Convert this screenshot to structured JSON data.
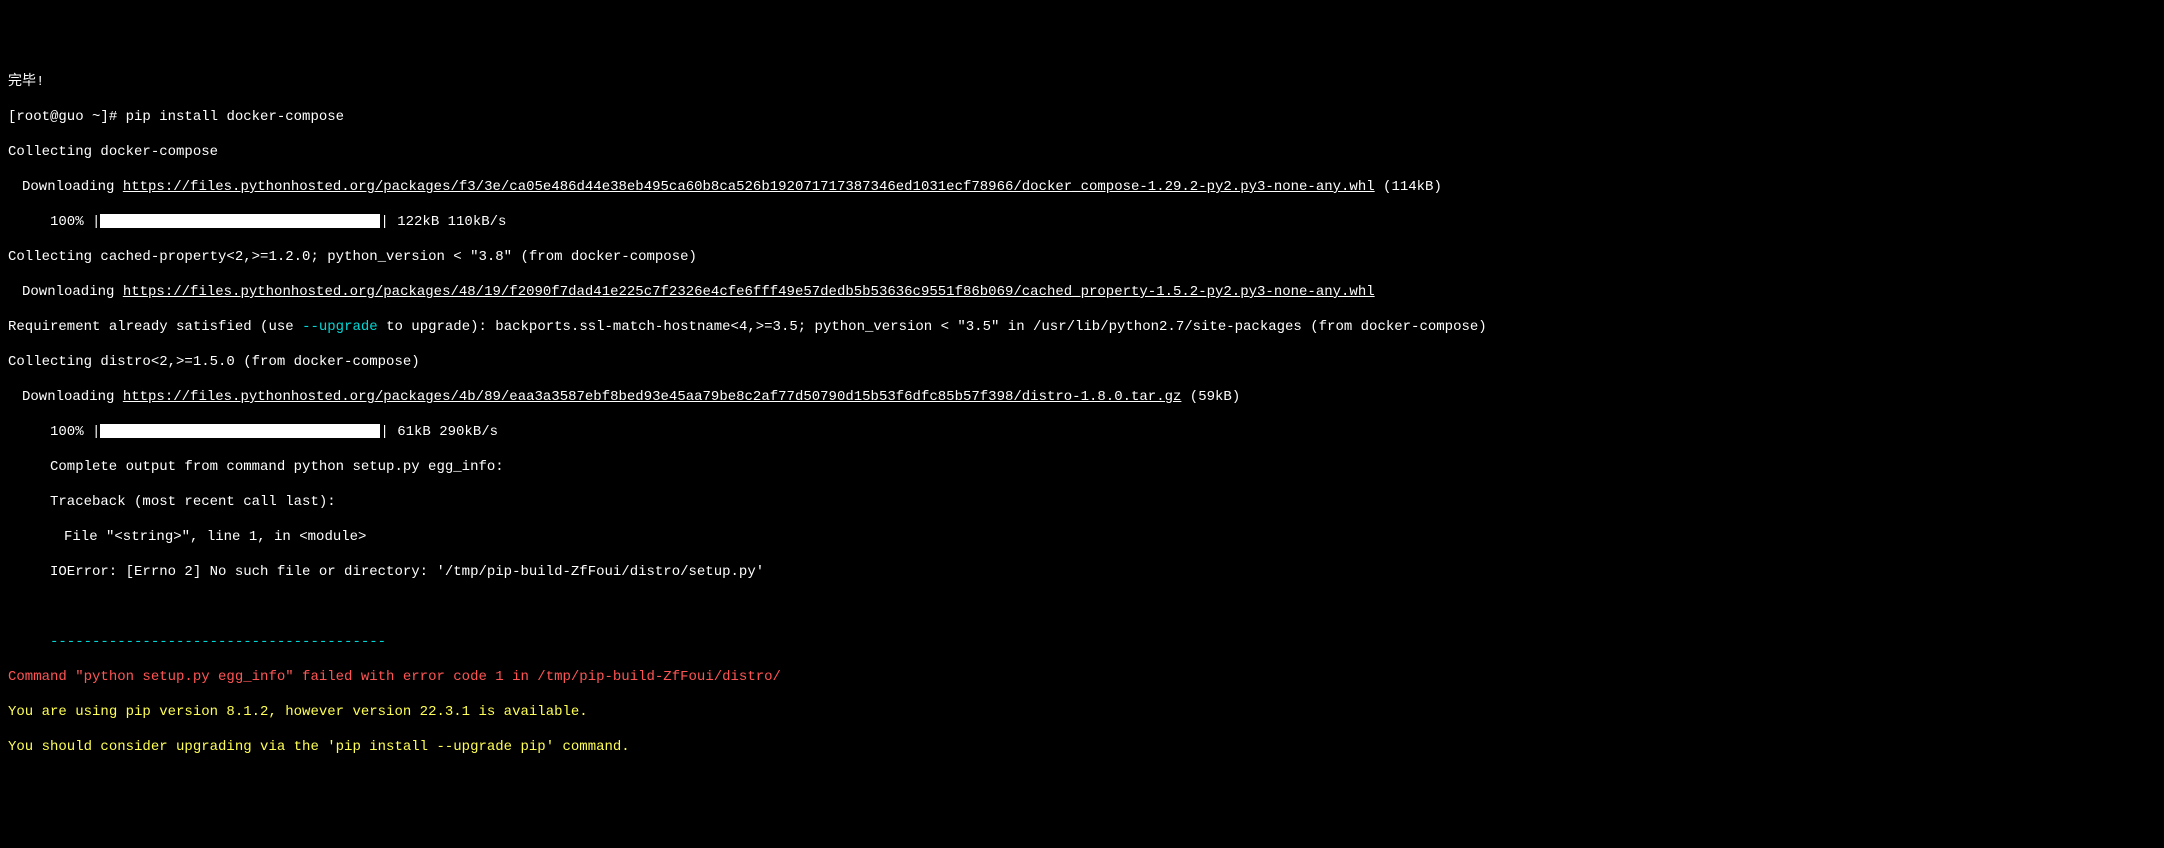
{
  "lines": {
    "done": "完毕!",
    "prompt_prefix": "[root@guo ~]# ",
    "command": "pip install docker-compose",
    "collecting1": "Collecting docker-compose",
    "download1_prefix": "Downloading ",
    "download1_url": "https://files.pythonhosted.org/packages/f3/3e/ca05e486d44e38eb495ca60b8ca526b192071717387346ed1031ecf78966/docker_compose-1.29.2-py2.py3-none-any.whl",
    "download1_size": " (114kB)",
    "progress1_pct": "100% |",
    "progress1_suffix": "| 122kB 110kB/s",
    "collecting2": "Collecting cached-property<2,>=1.2.0; python_version < \"3.8\" (from docker-compose)",
    "download2_prefix": "Downloading ",
    "download2_url": "https://files.pythonhosted.org/packages/48/19/f2090f7dad41e225c7f2326e4cfe6fff49e57dedb5b53636c9551f86b069/cached_property-1.5.2-py2.py3-none-any.whl",
    "req_sat_prefix": "Requirement already satisfied (use ",
    "req_sat_upgrade": "--upgrade",
    "req_sat_suffix": " to upgrade): backports.ssl-match-hostname<4,>=3.5; python_version < \"3.5\" in /usr/lib/python2.7/site-packages (from docker-compose)",
    "collecting3": "Collecting distro<2,>=1.5.0 (from docker-compose)",
    "download3_prefix": "Downloading ",
    "download3_url": "https://files.pythonhosted.org/packages/4b/89/eaa3a3587ebf8bed93e45aa79be8c2af77d50790d15b53f6dfc85b57f398/distro-1.8.0.tar.gz",
    "download3_size": " (59kB)",
    "progress2_pct": "100% |",
    "progress2_suffix": "| 61kB 290kB/s",
    "complete_output": "Complete output from command python setup.py egg_info:",
    "traceback": "Traceback (most recent call last):",
    "file_line": "File \"<string>\", line 1, in <module>",
    "ioerror": "IOError: [Errno 2] No such file or directory: '/tmp/pip-build-ZfFoui/distro/setup.py'",
    "dashes": "----------------------------------------",
    "cmd_failed": "Command \"python setup.py egg_info\" failed with error code 1 in /tmp/pip-build-ZfFoui/distro/",
    "pip_version": "You are using pip version 8.1.2, however version 22.3.1 is available.",
    "pip_upgrade": "You should consider upgrading via the 'pip install --upgrade pip' command."
  }
}
